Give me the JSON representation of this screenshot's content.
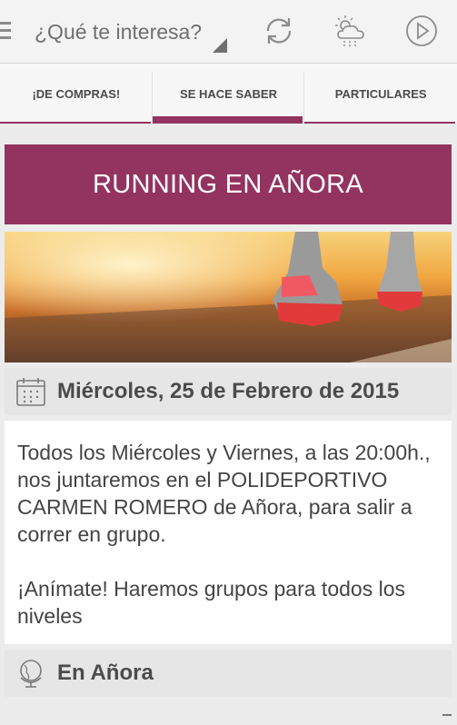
{
  "header": {
    "title": "¿Qué te interesa?",
    "icons": [
      "menu-icon",
      "dropdown-triangle-icon",
      "refresh-icon",
      "weather-icon",
      "play-icon"
    ]
  },
  "tabs": [
    {
      "label": "¡DE COMPRAS!",
      "active": false
    },
    {
      "label": "SE HACE SABER",
      "active": true
    },
    {
      "label": "PARTICULARES",
      "active": false
    }
  ],
  "event": {
    "title": "RUNNING EN AÑORA",
    "date": "Miércoles, 25 de Febrero de 2015",
    "description_1": "Todos los Miércoles y Viernes, a las 20:00h., nos juntaremos en el POLIDEPORTIVO CARMEN ROMERO de Añora, para salir a correr en grupo.",
    "description_2": "¡Anímate! Haremos grupos para todos los niveles",
    "location": "En Añora"
  },
  "colors": {
    "accent": "#93335f",
    "background": "#ececec"
  }
}
